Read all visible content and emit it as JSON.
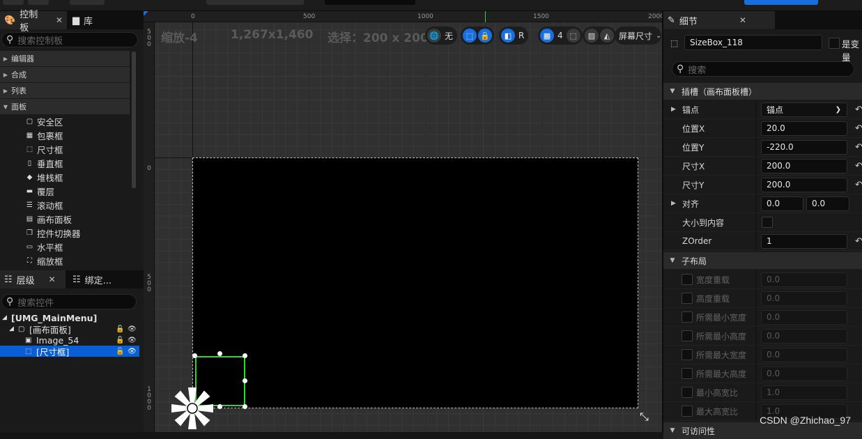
{
  "left_panel": {
    "tabs": [
      {
        "label": "控制板"
      },
      {
        "label": "库"
      }
    ],
    "search_placeholder": "搜索控制板",
    "categories": [
      {
        "label": "编辑器"
      },
      {
        "label": "合成"
      },
      {
        "label": "列表"
      },
      {
        "label": "面板"
      }
    ],
    "panel_items": [
      {
        "label": "安全区",
        "icon": "safe-zone-icon"
      },
      {
        "label": "包裹框",
        "icon": "wrap-box-icon"
      },
      {
        "label": "尺寸框",
        "icon": "size-box-icon"
      },
      {
        "label": "垂直框",
        "icon": "vertical-box-icon"
      },
      {
        "label": "堆栈框",
        "icon": "stack-box-icon"
      },
      {
        "label": "覆层",
        "icon": "overlay-icon"
      },
      {
        "label": "滚动框",
        "icon": "scroll-box-icon"
      },
      {
        "label": "画布面板",
        "icon": "canvas-panel-icon"
      },
      {
        "label": "控件切换器",
        "icon": "widget-switcher-icon"
      },
      {
        "label": "水平框",
        "icon": "horizontal-box-icon"
      },
      {
        "label": "缩放框",
        "icon": "scale-box-icon"
      }
    ],
    "hierarchy_tabs": [
      {
        "label": "层级"
      },
      {
        "label": "绑定..."
      }
    ],
    "hierarchy_search_placeholder": "搜索控件",
    "hierarchy": [
      {
        "label": "[UMG_MainMenu]"
      },
      {
        "label": "[画布面板]"
      },
      {
        "label": "Image_54"
      },
      {
        "label": "[尺寸框]"
      }
    ]
  },
  "canvas": {
    "ruler_top": [
      "0",
      "500",
      "1000",
      "1500",
      "2000"
    ],
    "ruler_left": [
      "500",
      "0",
      "500",
      "1000"
    ],
    "zoom_label": "缩放-4",
    "resolution": "1,267x1,460",
    "selection": "选择：200 x 200",
    "toolbar": {
      "world_label": "无",
      "r_label": "R",
      "grid_count": "4",
      "screen_size_label": "屏幕尺寸"
    }
  },
  "details": {
    "tab_label": "细节",
    "widget_name": "SizeBox_118",
    "is_variable_label": "是变量",
    "search_placeholder": "搜索",
    "slot_section": "插槽（画布面板槽）",
    "anchor_label": "锚点",
    "anchor_value": "锚点",
    "position_x_label": "位置X",
    "position_x": "20.0",
    "position_y_label": "位置Y",
    "position_y": "-220.0",
    "size_x_label": "尺寸X",
    "size_x": "200.0",
    "size_y_label": "尺寸Y",
    "size_y": "200.0",
    "alignment_label": "对齐",
    "alignment_x": "0.0",
    "alignment_y": "0.0",
    "size_to_content_label": "大小到内容",
    "zorder_label": "ZOrder",
    "zorder": "1",
    "child_layout_section": "子布局",
    "child_props": [
      {
        "label": "宽度重载",
        "value": "0.0"
      },
      {
        "label": "高度重载",
        "value": "0.0"
      },
      {
        "label": "所需最小宽度",
        "value": "0.0"
      },
      {
        "label": "所需最小高度",
        "value": "0.0"
      },
      {
        "label": "所需最大宽度",
        "value": "0.0"
      },
      {
        "label": "所需最大高度",
        "value": "0.0"
      },
      {
        "label": "最小高宽比",
        "value": "1.0"
      },
      {
        "label": "最大高宽比",
        "value": "1.0"
      }
    ],
    "accessibility_section": "可访问性"
  },
  "watermark": "CSDN @Zhichao_97",
  "colors": {
    "accent": "#0b5fd6",
    "selection_outline": "#2bd92b",
    "panel_bg": "#1a1a1a",
    "canvas_bg": "#303030"
  }
}
